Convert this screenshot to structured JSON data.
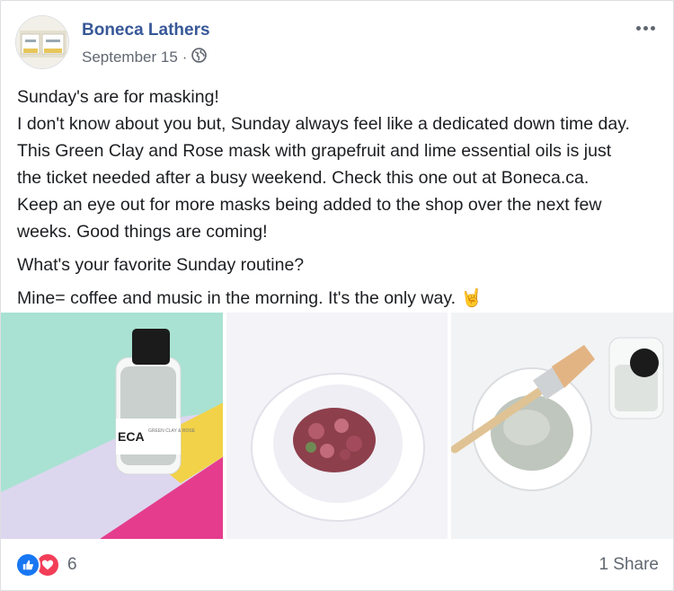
{
  "post": {
    "author": "Boneca Lathers",
    "date": "September 15",
    "separator": "·",
    "privacy_icon": "globe-icon",
    "menu_icon": "more-options-icon",
    "paragraphs": [
      [
        "Sunday's are for masking!",
        "I don't know about you but, Sunday always feel like a dedicated down time day.",
        "This Green Clay and Rose mask with grapefruit and lime essential oils is just",
        "the ticket needed after a busy weekend. Check this one out at Boneca.ca.",
        "Keep an eye out for more masks being added to the shop over the next few",
        "weeks. Good things are coming!"
      ],
      [
        "What's your favorite Sunday routine?"
      ],
      [
        "Mine= coffee and music in the morning. It's the only way."
      ]
    ],
    "emoji": "🤘",
    "photos": [
      {
        "name": "photo-bottle-on-colored-paper",
        "label": "ECA",
        "sublabel": "GREEN CLAY & ROSE"
      },
      {
        "name": "photo-rose-petals-in-bowl"
      },
      {
        "name": "photo-clay-mask-with-brush"
      }
    ],
    "reaction_count": "6",
    "share_text": "1 Share",
    "colors": {
      "author": "#385898",
      "like": "#1877f2",
      "love": "#f33e58",
      "muted": "#606770"
    }
  }
}
